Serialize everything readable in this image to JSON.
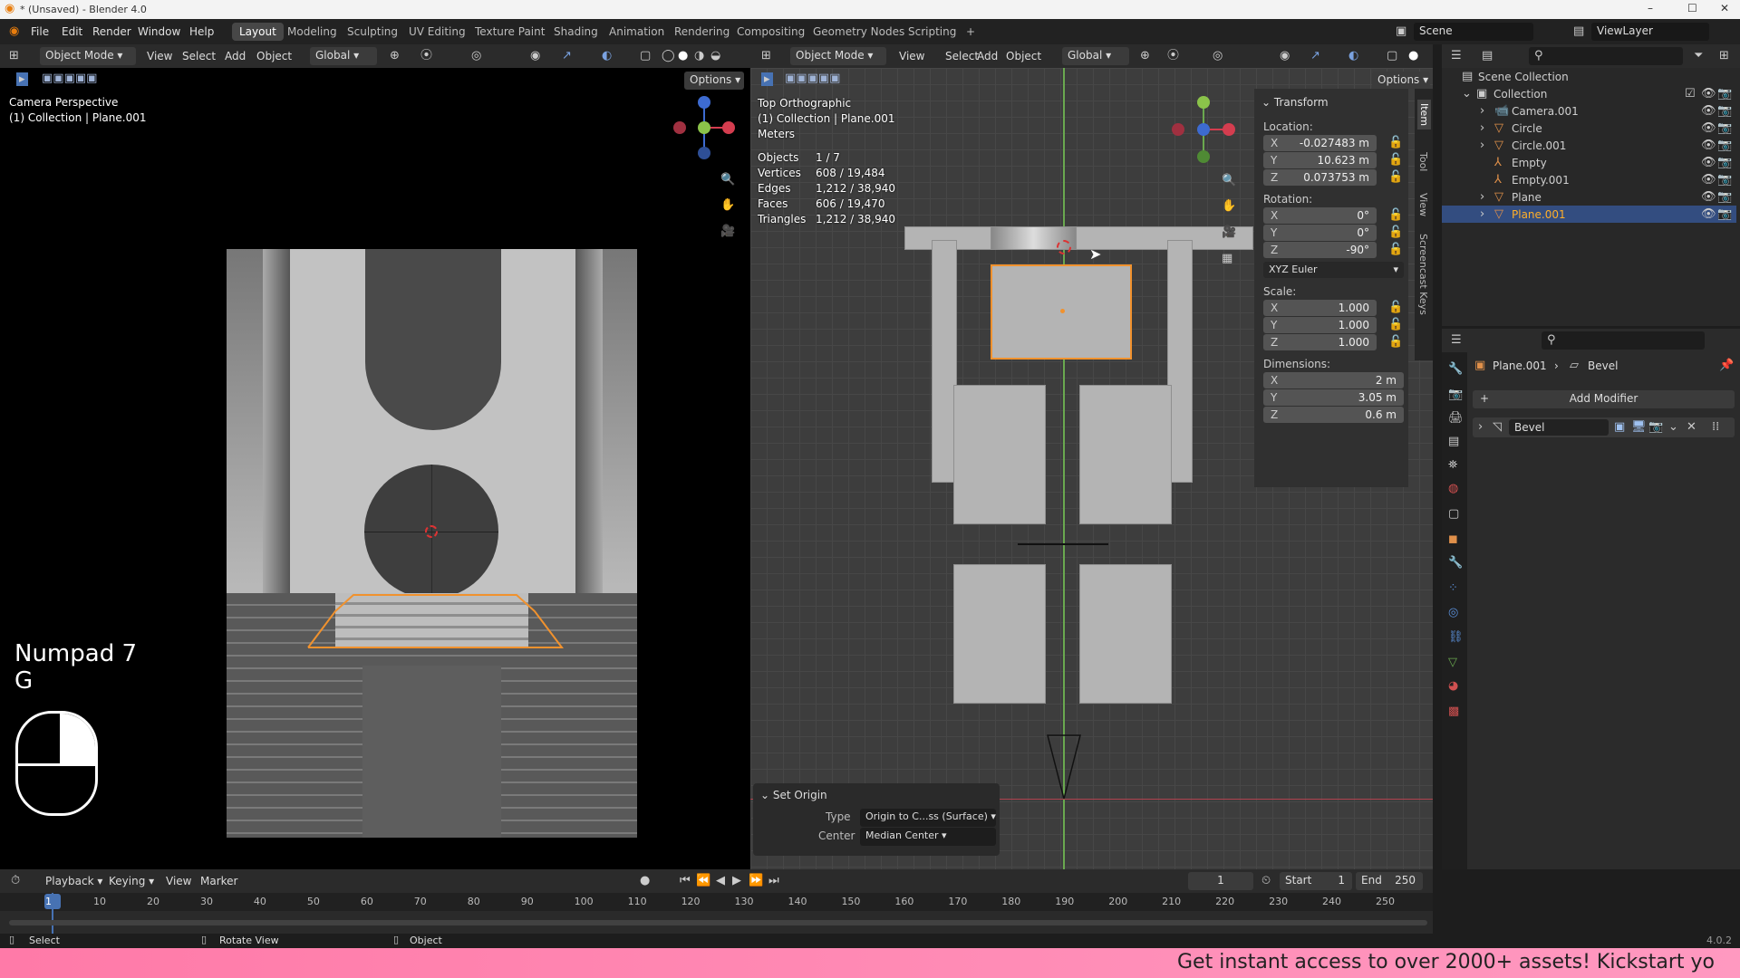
{
  "window": {
    "title": "* (Unsaved) - Blender 4.0",
    "controls": [
      "–",
      "☐",
      "✕"
    ]
  },
  "menu": {
    "items": [
      "File",
      "Edit",
      "Render",
      "Window",
      "Help"
    ]
  },
  "workspaces": {
    "tabs": [
      "Layout",
      "Modeling",
      "Sculpting",
      "UV Editing",
      "Texture Paint",
      "Shading",
      "Animation",
      "Rendering",
      "Compositing",
      "Geometry Nodes",
      "Scripting"
    ],
    "add": "+",
    "active": "Layout"
  },
  "scene": {
    "name": "Scene",
    "view_layer": "ViewLayer"
  },
  "left_viewport": {
    "mode": "Object Mode",
    "menus": [
      "View",
      "Select",
      "Add",
      "Object"
    ],
    "orientation": "Global",
    "options": "Options",
    "view_name": "Camera Perspective",
    "collection": "(1) Collection | Plane.001",
    "key_hint_1": "Numpad 7",
    "key_hint_2": "G"
  },
  "right_viewport": {
    "mode": "Object Mode",
    "menus": [
      "View",
      "Select",
      "Add",
      "Object"
    ],
    "orientation": "Global",
    "options": "Options",
    "view_name": "Top Orthographic",
    "collection": "(1) Collection | Plane.001",
    "units": "Meters",
    "stats": [
      {
        "k": "Objects",
        "v": "1 / 7"
      },
      {
        "k": "Vertices",
        "v": "608 / 19,484"
      },
      {
        "k": "Edges",
        "v": "1,212 / 38,940"
      },
      {
        "k": "Faces",
        "v": "606 / 19,470"
      },
      {
        "k": "Triangles",
        "v": "1,212 / 38,940"
      }
    ]
  },
  "side_tabs": [
    "Item",
    "Tool",
    "View",
    "Screencast Keys"
  ],
  "transform": {
    "title": "Transform",
    "location_label": "Location:",
    "rotation_label": "Rotation:",
    "scale_label": "Scale:",
    "dimensions_label": "Dimensions:",
    "euler": "XYZ Euler",
    "location": [
      {
        "k": "X",
        "v": "-0.027483 m"
      },
      {
        "k": "Y",
        "v": "10.623 m"
      },
      {
        "k": "Z",
        "v": "0.073753 m"
      }
    ],
    "rotation": [
      {
        "k": "X",
        "v": "0°"
      },
      {
        "k": "Y",
        "v": "0°"
      },
      {
        "k": "Z",
        "v": "-90°"
      }
    ],
    "scale": [
      {
        "k": "X",
        "v": "1.000"
      },
      {
        "k": "Y",
        "v": "1.000"
      },
      {
        "k": "Z",
        "v": "1.000"
      }
    ],
    "dimensions": [
      {
        "k": "X",
        "v": "2 m"
      },
      {
        "k": "Y",
        "v": "3.05 m"
      },
      {
        "k": "Z",
        "v": "0.6 m"
      }
    ]
  },
  "set_origin": {
    "title": "Set Origin",
    "type_label": "Type",
    "type_value": "Origin to C...ss (Surface)",
    "center_label": "Center",
    "center_value": "Median Center"
  },
  "outliner": {
    "root": "Scene Collection",
    "collection": "Collection",
    "items": [
      "Camera.001",
      "Circle",
      "Circle.001",
      "Empty",
      "Empty.001",
      "Plane",
      "Plane.001"
    ],
    "selected": "Plane.001"
  },
  "properties": {
    "object": "Plane.001",
    "modifier_crumb": "Bevel",
    "add_modifier": "Add Modifier",
    "modifier": "Bevel"
  },
  "timeline": {
    "menus": [
      "Playback",
      "Keying",
      "View",
      "Marker"
    ],
    "current_frame": "1",
    "start_label": "Start",
    "start": "1",
    "end_label": "End",
    "end": "250",
    "ticks": [
      "1",
      "10",
      "20",
      "30",
      "40",
      "50",
      "60",
      "70",
      "80",
      "90",
      "100",
      "110",
      "120",
      "130",
      "140",
      "150",
      "160",
      "170",
      "180",
      "190",
      "200",
      "210",
      "220",
      "230",
      "240",
      "250"
    ]
  },
  "status": {
    "select": "Select",
    "rotate": "Rotate View",
    "object": "Object",
    "version": "4.0.2"
  },
  "banner": {
    "text": "Get instant access to over 2000+ assets! Kickstart yo"
  },
  "colors": {
    "accent": "#4772b3",
    "selected_outline": "#f1922e",
    "banner": "#ff80b3"
  }
}
